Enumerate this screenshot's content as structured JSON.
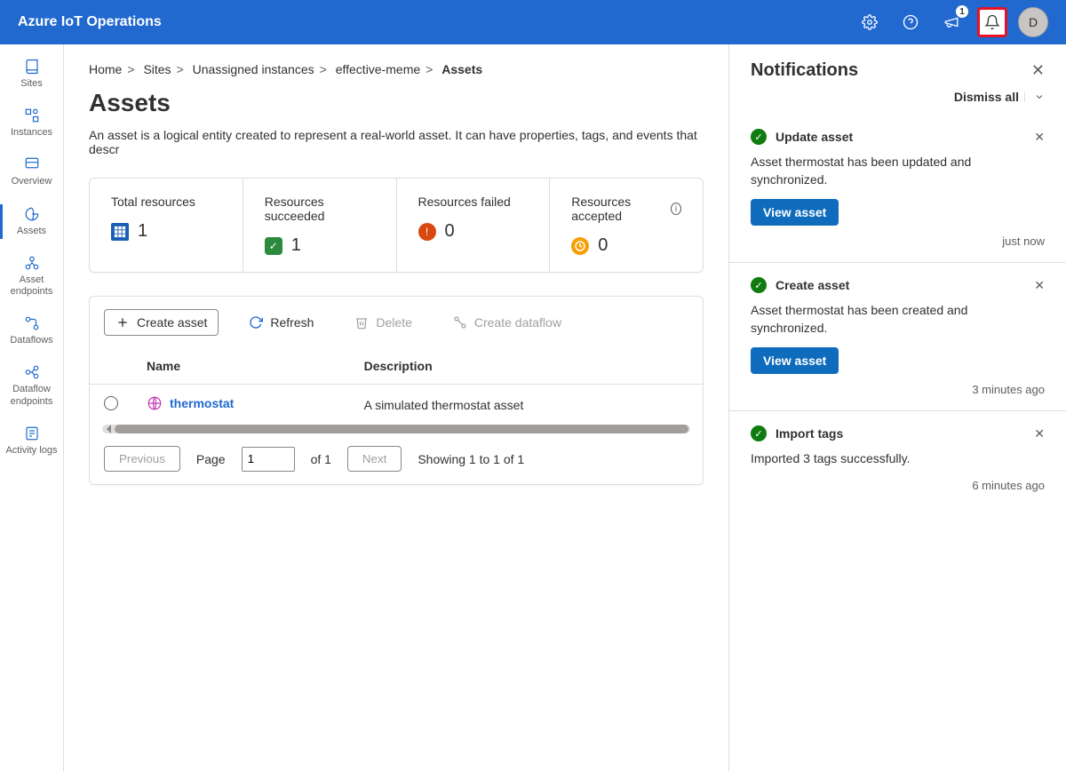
{
  "header": {
    "title": "Azure IoT Operations",
    "badge_count": "1",
    "avatar_initial": "D"
  },
  "sidebar": {
    "items": [
      {
        "label": "Sites"
      },
      {
        "label": "Instances"
      },
      {
        "label": "Overview"
      },
      {
        "label": "Assets"
      },
      {
        "label": "Asset endpoints"
      },
      {
        "label": "Dataflows"
      },
      {
        "label": "Dataflow endpoints"
      },
      {
        "label": "Activity logs"
      }
    ]
  },
  "breadcrumb": {
    "items": [
      "Home",
      "Sites",
      "Unassigned instances",
      "effective-meme",
      "Assets"
    ]
  },
  "page": {
    "title": "Assets",
    "description": "An asset is a logical entity created to represent a real-world asset. It can have properties, tags, and events that descr"
  },
  "stats": {
    "total": {
      "label": "Total resources",
      "value": "1"
    },
    "succeeded": {
      "label": "Resources succeeded",
      "value": "1"
    },
    "failed": {
      "label": "Resources failed",
      "value": "0"
    },
    "accepted": {
      "label": "Resources accepted",
      "value": "0"
    }
  },
  "toolbar": {
    "create": "Create asset",
    "refresh": "Refresh",
    "delete": "Delete",
    "dataflow": "Create dataflow"
  },
  "table": {
    "col_name": "Name",
    "col_desc": "Description",
    "rows": [
      {
        "name": "thermostat",
        "desc": "A simulated thermostat asset"
      }
    ]
  },
  "pager": {
    "prev": "Previous",
    "next": "Next",
    "page_label": "Page",
    "page_value": "1",
    "of": "of 1",
    "showing": "Showing 1 to 1 of 1"
  },
  "panel": {
    "title": "Notifications",
    "dismiss": "Dismiss all",
    "items": [
      {
        "title": "Update asset",
        "body": "Asset thermostat has been updated and synchronized.",
        "action": "View asset",
        "time": "just now"
      },
      {
        "title": "Create asset",
        "body": "Asset thermostat has been created and synchronized.",
        "action": "View asset",
        "time": "3 minutes ago"
      },
      {
        "title": "Import tags",
        "body": "Imported 3 tags successfully.",
        "action": "",
        "time": "6 minutes ago"
      }
    ]
  }
}
